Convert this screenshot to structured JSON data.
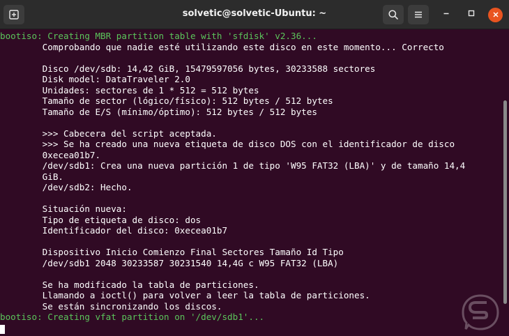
{
  "window": {
    "title": "solvetic@solvetic-Ubuntu: ~"
  },
  "icons": {
    "new_tab": "new-tab-icon",
    "search": "search-icon",
    "menu": "hamburger-menu-icon",
    "minimize": "minimize-icon",
    "maximize": "maximize-icon",
    "close": "close-icon"
  },
  "colors": {
    "terminal_bg": "#300a24",
    "prompt_green": "#5bc45b",
    "close_button": "#e95420",
    "titlebar": "#2c2c2c"
  },
  "terminal": {
    "lines": [
      {
        "text": "bootiso: Creating MBR partition table with 'sfdisk' v2.36...",
        "style": "green"
      },
      {
        "text": "        Comprobando que nadie esté utilizando este disco en este momento... Correcto",
        "style": "white"
      },
      {
        "text": "",
        "style": "white"
      },
      {
        "text": "        Disco /dev/sdb: 14,42 GiB, 15479597056 bytes, 30233588 sectores",
        "style": "white"
      },
      {
        "text": "        Disk model: DataTraveler 2.0",
        "style": "white"
      },
      {
        "text": "        Unidades: sectores de 1 * 512 = 512 bytes",
        "style": "white"
      },
      {
        "text": "        Tamaño de sector (lógico/físico): 512 bytes / 512 bytes",
        "style": "white"
      },
      {
        "text": "        Tamaño de E/S (mínimo/óptimo): 512 bytes / 512 bytes",
        "style": "white"
      },
      {
        "text": "",
        "style": "white"
      },
      {
        "text": "        >>> Cabecera del script aceptada.",
        "style": "white"
      },
      {
        "text": "        >>> Se ha creado una nueva etiqueta de disco DOS con el identificador de disco",
        "style": "white"
      },
      {
        "text": "        0xecea01b7.",
        "style": "white"
      },
      {
        "text": "        /dev/sdb1: Crea una nueva partición 1 de tipo 'W95 FAT32 (LBA)' y de tamaño 14,4",
        "style": "white"
      },
      {
        "text": "        GiB.",
        "style": "white"
      },
      {
        "text": "        /dev/sdb2: Hecho.",
        "style": "white"
      },
      {
        "text": "",
        "style": "white"
      },
      {
        "text": "        Situación nueva:",
        "style": "white"
      },
      {
        "text": "        Tipo de etiqueta de disco: dos",
        "style": "white"
      },
      {
        "text": "        Identificador del disco: 0xecea01b7",
        "style": "white"
      },
      {
        "text": "",
        "style": "white"
      },
      {
        "text": "        Dispositivo Inicio Comienzo Final Sectores Tamaño Id Tipo",
        "style": "white"
      },
      {
        "text": "        /dev/sdb1 2048 30233587 30231540 14,4G c W95 FAT32 (LBA)",
        "style": "white"
      },
      {
        "text": "",
        "style": "white"
      },
      {
        "text": "        Se ha modificado la tabla de particiones.",
        "style": "white"
      },
      {
        "text": "        Llamando a ioctl() para volver a leer la tabla de particiones.",
        "style": "white"
      },
      {
        "text": "        Se están sincronizando los discos.",
        "style": "white"
      },
      {
        "text": "bootiso: Creating vfat partition on '/dev/sdb1'...",
        "style": "green"
      }
    ]
  }
}
